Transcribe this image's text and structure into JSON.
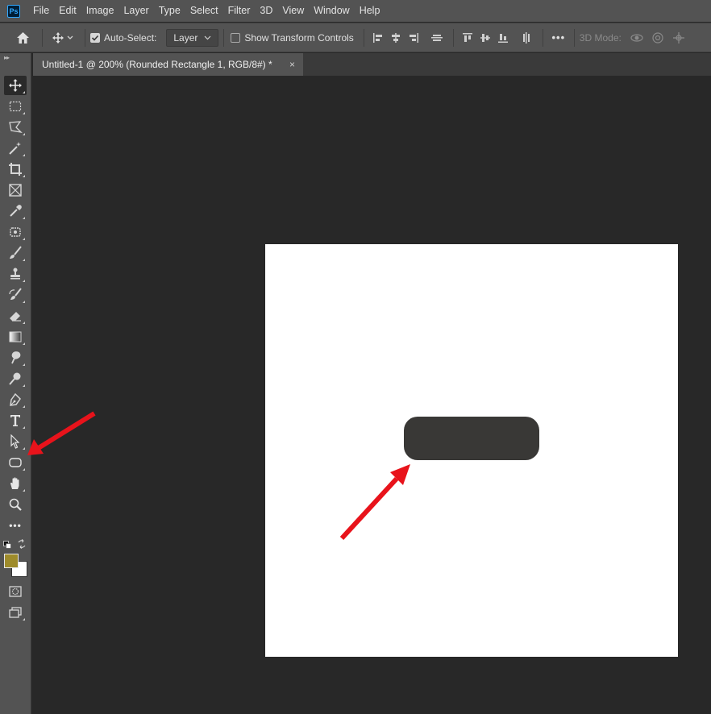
{
  "app": {
    "logo_text": "Ps"
  },
  "menubar": {
    "items": [
      "File",
      "Edit",
      "Image",
      "Layer",
      "Type",
      "Select",
      "Filter",
      "3D",
      "View",
      "Window",
      "Help"
    ]
  },
  "options": {
    "auto_select_label": "Auto-Select:",
    "auto_select_checked": true,
    "auto_select_value": "Layer",
    "show_transform_label": "Show Transform Controls",
    "show_transform_checked": false,
    "more_label": "•••",
    "mode_3d_label": "3D Mode:"
  },
  "document": {
    "tab_title": "Untitled-1 @ 200% (Rounded Rectangle 1, RGB/8#) *",
    "close_label": "×"
  },
  "colors": {
    "foreground": "#9e8b2b",
    "background": "#ffffff",
    "shape_fill": "#393836",
    "annotation_arrow": "#e8131b"
  },
  "toolbar": {
    "active_tool": "move-tool",
    "more_label": "•••"
  }
}
